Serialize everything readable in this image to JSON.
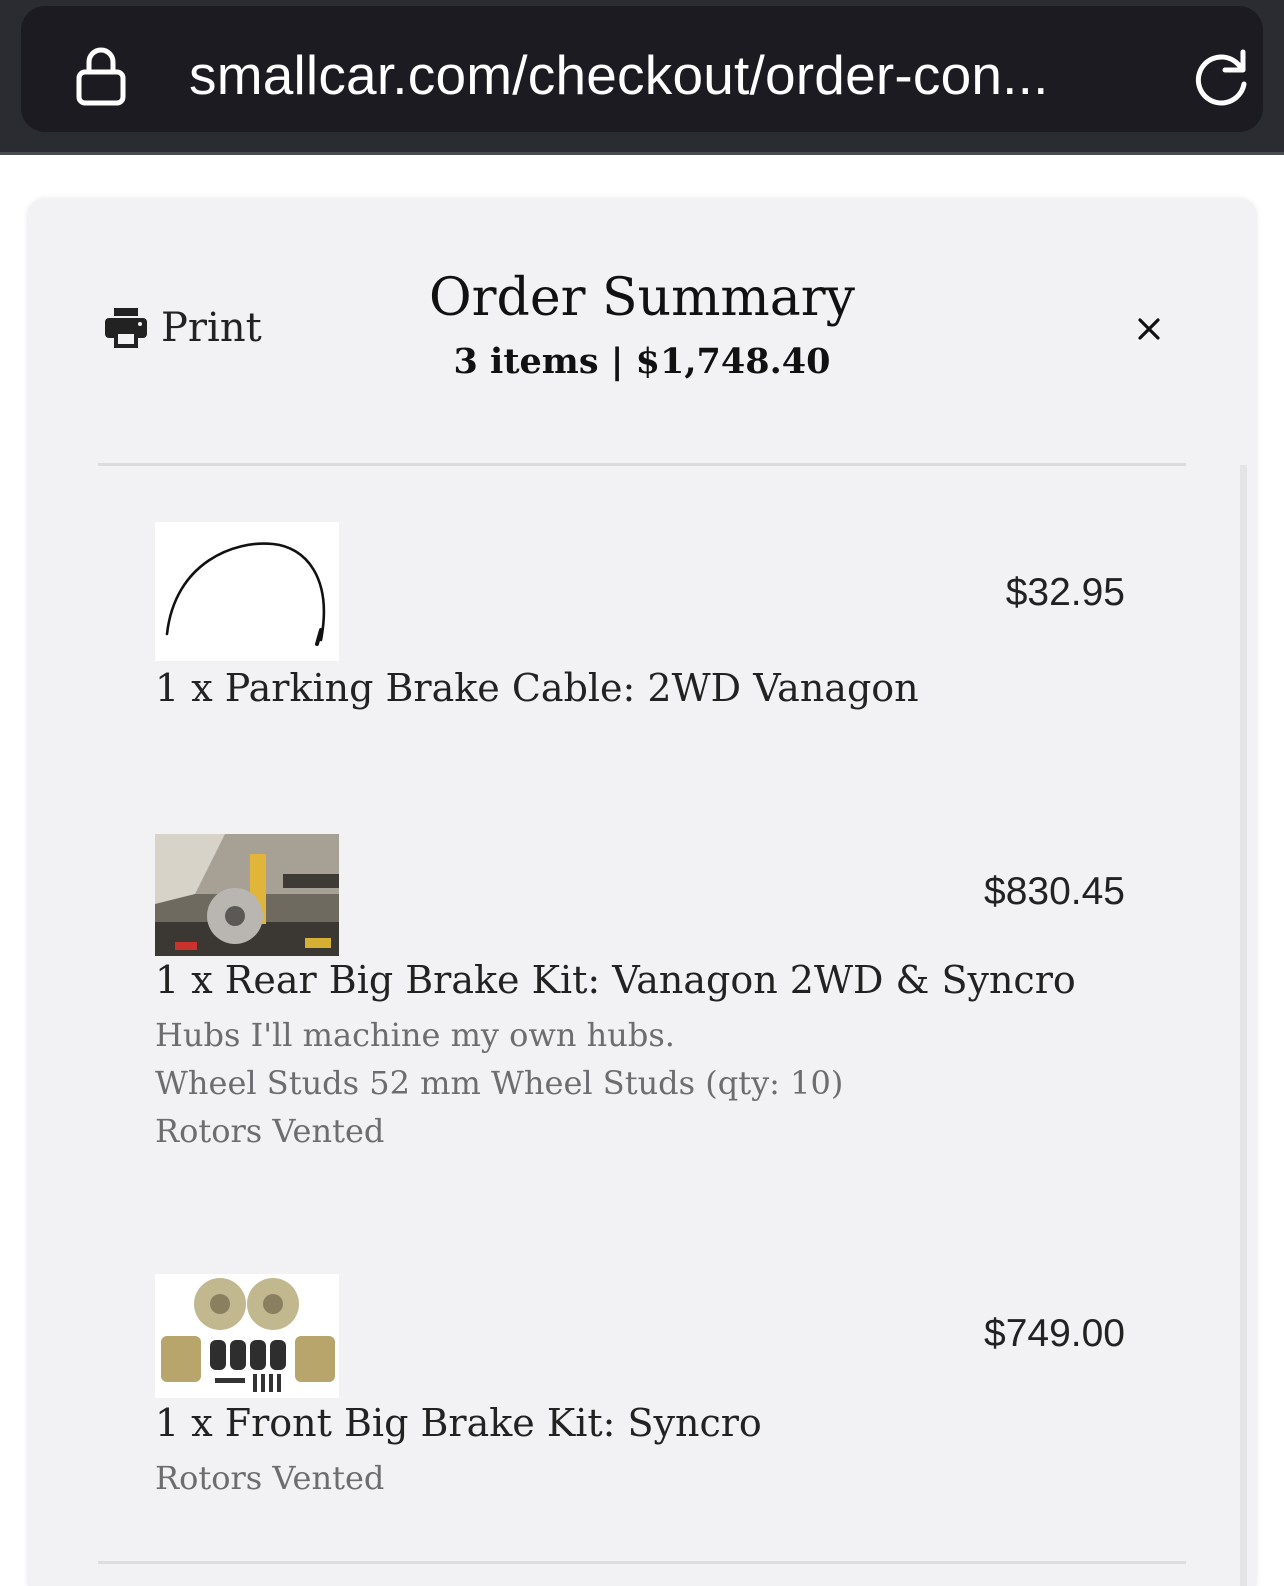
{
  "browser": {
    "url": "smallcar.com/checkout/order-con..."
  },
  "header": {
    "print_label": "Print",
    "title": "Order Summary",
    "subtitle": "3 items | $1,748.40"
  },
  "items": [
    {
      "name": "1 x Parking Brake Cable: 2WD Vanagon",
      "price": "$32.95",
      "options": []
    },
    {
      "name": "1 x Rear Big Brake Kit: Vanagon 2WD & Syncro",
      "price": "$830.45",
      "options": [
        "Hubs I'll machine my own hubs.",
        "Wheel Studs 52 mm Wheel Studs (qty: 10)",
        "Rotors Vented"
      ]
    },
    {
      "name": "1 x Front Big Brake Kit: Syncro",
      "price": "$749.00",
      "options": [
        "Rotors Vented"
      ]
    }
  ],
  "icons": {
    "lock": "lock-icon",
    "reload": "reload-icon",
    "printer": "printer-icon",
    "close": "close-icon"
  }
}
